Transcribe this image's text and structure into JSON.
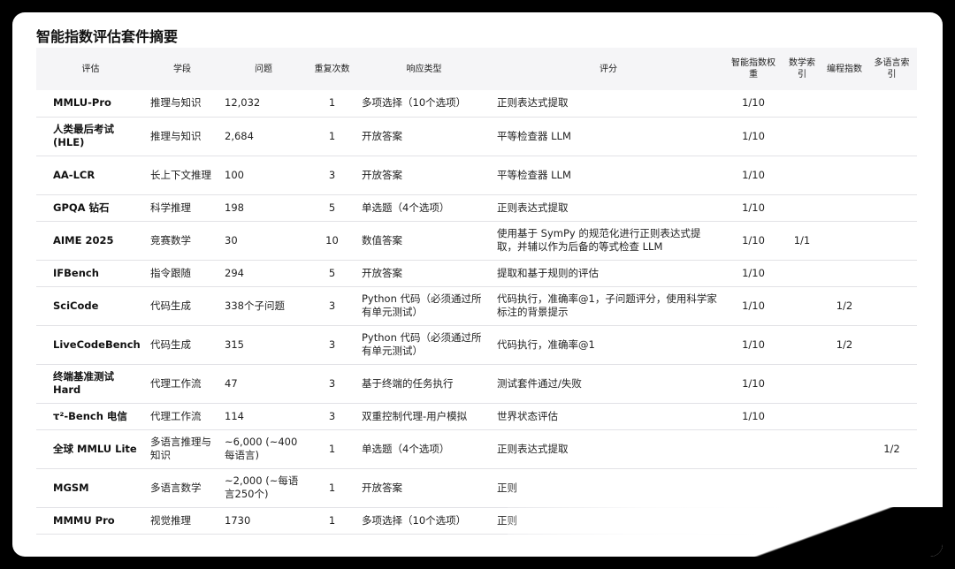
{
  "title": "智能指数评估套件摘要",
  "columns": [
    "评估",
    "学段",
    "问题",
    "重复次数",
    "响应类型",
    "评分",
    "智能指数权重",
    "数学索引",
    "编程指数",
    "多语言索引"
  ],
  "rows": [
    [
      "MMLU-Pro",
      "推理与知识",
      "12,032",
      "1",
      "多项选择（10个选项）",
      "正则表达式提取",
      "1/10",
      "",
      "",
      ""
    ],
    [
      "人类最后考试 (HLE)",
      "推理与知识",
      "2,684",
      "1",
      "开放答案",
      "平等检查器 LLM",
      "1/10",
      "",
      "",
      ""
    ],
    [
      "AA-LCR",
      "长上下文推理",
      "100",
      "3",
      "开放答案",
      "平等检查器 LLM",
      "1/10",
      "",
      "",
      ""
    ],
    [
      "GPQA 钻石",
      "科学推理",
      "198",
      "5",
      "单选题（4个选项）",
      "正则表达式提取",
      "1/10",
      "",
      "",
      ""
    ],
    [
      "AIME 2025",
      "竞赛数学",
      "30",
      "10",
      "数值答案",
      "使用基于 SymPy 的规范化进行正则表达式提取，并辅以作为后备的等式检查 LLM",
      "1/10",
      "1/1",
      "",
      ""
    ],
    [
      "IFBench",
      "指令跟随",
      "294",
      "5",
      "开放答案",
      "提取和基于规则的评估",
      "1/10",
      "",
      "",
      ""
    ],
    [
      "SciCode",
      "代码生成",
      "338个子问题",
      "3",
      "Python 代码（必须通过所有单元测试）",
      "代码执行，准确率@1，子问题评分，使用科学家标注的背景提示",
      "1/10",
      "",
      "1/2",
      ""
    ],
    [
      "LiveCodeBench",
      "代码生成",
      "315",
      "3",
      "Python 代码（必须通过所有单元测试）",
      "代码执行，准确率@1",
      "1/10",
      "",
      "1/2",
      ""
    ],
    [
      "终端基准测试 Hard",
      "代理工作流",
      "47",
      "3",
      "基于终端的任务执行",
      "测试套件通过/失败",
      "1/10",
      "",
      "",
      ""
    ],
    [
      "τ²-Bench 电信",
      "代理工作流",
      "114",
      "3",
      "双重控制代理-用户模拟",
      "世界状态评估",
      "1/10",
      "",
      "",
      ""
    ],
    [
      "全球 MMLU Lite",
      "多语言推理与知识",
      "~6,000 (~400每语言)",
      "1",
      "单选题（4个选项）",
      "正则表达式提取",
      "",
      "",
      "",
      "1/2"
    ],
    [
      "MGSM",
      "多语言数学",
      "~2,000 (~每语言250个)",
      "1",
      "开放答案",
      "正则",
      "",
      "",
      "",
      ""
    ],
    [
      "MMMU Pro",
      "视觉推理",
      "1730",
      "1",
      "多项选择（10个选项）",
      "正则",
      "",
      "",
      "",
      ""
    ]
  ]
}
